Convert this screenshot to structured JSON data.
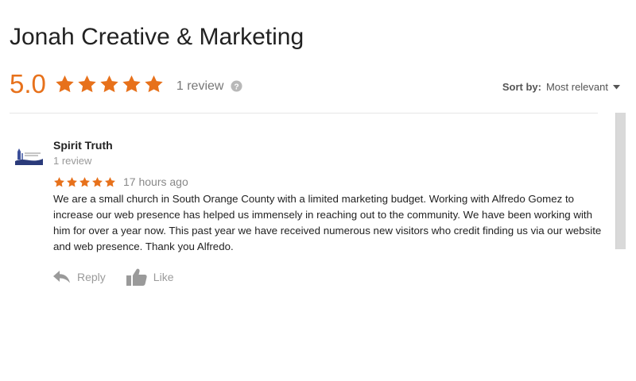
{
  "business": {
    "title": "Jonah Creative & Marketing",
    "rating": "5.0",
    "stars": 5,
    "review_count_label": "1 review",
    "help_icon": "help-circle-icon"
  },
  "sort": {
    "label": "Sort by:",
    "value": "Most relevant",
    "caret_icon": "caret-down-icon"
  },
  "review": {
    "reviewer_name": "Spirit Truth",
    "reviewer_review_count": "1 review",
    "stars": 5,
    "time": "17 hours ago",
    "text": "We are a small church in South Orange County with a limited marketing budget. Working with Alfredo Gomez to increase our web presence has helped us immensely in reaching out to the community. We have been working with him for over a year now. This past year we have received numerous new visitors who credit finding us via our website and web presence. Thank you Alfredo.",
    "actions": {
      "reply_label": "Reply",
      "reply_icon": "reply-icon",
      "like_label": "Like",
      "like_icon": "thumbs-up-icon"
    }
  },
  "colors": {
    "star": "#e7711b",
    "score": "#e7711b",
    "muted": "#999999"
  }
}
